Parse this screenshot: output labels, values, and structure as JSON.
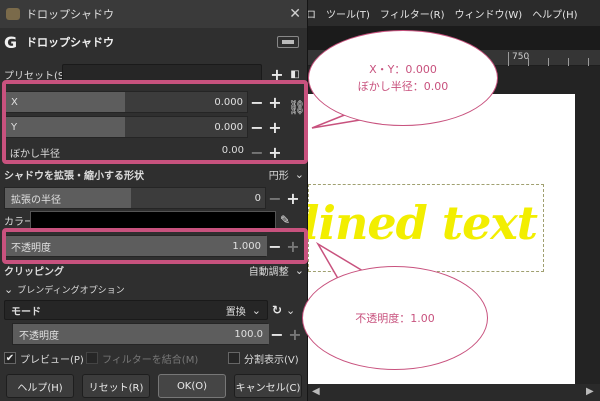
{
  "main_window": {
    "menu": [
      "ロ",
      "ツール(T)",
      "フィルター(R)",
      "ウィンドウ(W)",
      "ヘルプ(H)"
    ],
    "ruler_label": "750",
    "canvas_text": "lined text"
  },
  "dialog": {
    "window_title": "ドロップシャドウ",
    "header_title": "ドロップシャドウ",
    "preset_label": "プリセット(S):",
    "x_label": "X",
    "x_value": "0.000",
    "y_label": "Y",
    "y_value": "0.000",
    "blur_label": "ぼかし半径",
    "blur_value": "0.00",
    "grow_shape_label": "シャドウを拡張・縮小する形状",
    "grow_shape_value": "円形",
    "grow_radius_label": "拡張の半径",
    "grow_radius_value": "0",
    "color_label": "カラー",
    "opacity_label": "不透明度",
    "opacity_value": "1.000",
    "clipping_label": "クリッピング",
    "clipping_value": "自動調整",
    "blending_label": "ブレンディングオプション",
    "mode_label": "モード",
    "mode_value": "置換",
    "blend_opacity_label": "不透明度",
    "blend_opacity_value": "100.0",
    "preview_label": "プレビュー(P)",
    "merge_filter_label": "フィルターを結合(M)",
    "split_view_label": "分割表示(V)",
    "buttons": {
      "help": "ヘルプ(H)",
      "reset": "リセット(R)",
      "ok": "OK(O)",
      "cancel": "キャンセル(C)"
    }
  },
  "callouts": {
    "top_line1": "X・Y：0.000",
    "top_line2": "ぼかし半径：0.00",
    "bottom": "不透明度：1.00"
  },
  "colors": {
    "accent": "#c8527e",
    "canvas_text": "#f2ee00",
    "shadow_color": "#000000"
  }
}
